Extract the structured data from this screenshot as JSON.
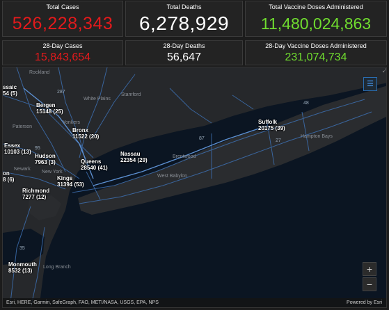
{
  "stats": {
    "total_cases": {
      "label": "Total Cases",
      "value": "526,228,343",
      "color": "#e31a1c"
    },
    "total_deaths": {
      "label": "Total Deaths",
      "value": "6,278,929",
      "color": "#ffffff"
    },
    "total_vaccine": {
      "label": "Total Vaccine Doses Administered",
      "value": "11,480,024,863",
      "color": "#70dd2f"
    },
    "cases_28": {
      "label": "28-Day Cases",
      "value": "15,843,654",
      "color": "#e31a1c"
    },
    "deaths_28": {
      "label": "28-Day Deaths",
      "value": "56,647",
      "color": "#ffffff"
    },
    "vaccine_28": {
      "label": "28-Day Vaccine Doses Administered",
      "value": "231,074,734",
      "color": "#70dd2f"
    }
  },
  "map": {
    "counties": [
      {
        "name": "Bergen",
        "value": "15148 (25)"
      },
      {
        "name": "Bronx",
        "value": "11522 (20)"
      },
      {
        "name": "Essex",
        "value": "10103 (13)"
      },
      {
        "name": "Hudson",
        "value": "7963 (3)"
      },
      {
        "name": "Queens",
        "value": "28540 (41)"
      },
      {
        "name": "Nassau",
        "value": "22354 (29)"
      },
      {
        "name": "Suffolk",
        "value": "20175 (39)"
      },
      {
        "name": "Kings",
        "value": "31394 (53)"
      },
      {
        "name": "Richmond",
        "value": "7277 (12)"
      },
      {
        "name": "Monmouth",
        "value": "8532 (13)"
      },
      {
        "name": "ssaic",
        "value": "54 (5)"
      },
      {
        "name": "on",
        "value": "8 (6)"
      }
    ],
    "places": [
      "Rockland",
      "White Plains",
      "Stamford",
      "Paterson",
      "Yonkers",
      "Newark",
      "New York",
      "Brentwood",
      "West Babylon",
      "Hampton Bays",
      "Long Branch"
    ],
    "road_shields": [
      "287",
      "95",
      "87",
      "27",
      "48",
      "35"
    ],
    "zoom_in": "+",
    "zoom_out": "−",
    "attribution": "Esri, HERE, Garmin, SafeGraph, FAO, METI/NASA, USGS, EPA, NPS",
    "powered_by": "Powered by Esri"
  }
}
